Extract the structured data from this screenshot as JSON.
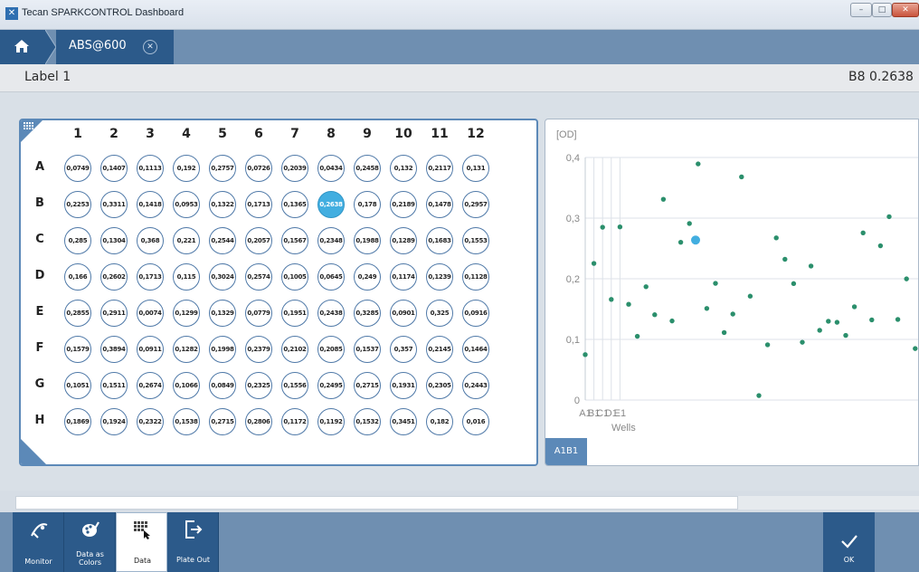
{
  "window": {
    "title": "Tecan SPARKCONTROL Dashboard",
    "app_icon": "tecan-logo-icon"
  },
  "nav": {
    "home_icon": "home-icon",
    "tab_label": "ABS@600",
    "tab_close_icon": "close-circle-icon"
  },
  "label_bar": {
    "left": "Label 1",
    "right": "B8 0.2638"
  },
  "plate": {
    "columns": [
      "1",
      "2",
      "3",
      "4",
      "5",
      "6",
      "7",
      "8",
      "9",
      "10",
      "11",
      "12"
    ],
    "rows": [
      "A",
      "B",
      "C",
      "D",
      "E",
      "F",
      "G",
      "H"
    ],
    "values": [
      [
        "0,0749",
        "0,1407",
        "0,1113",
        "0,192",
        "0,2757",
        "0,0726",
        "0,2039",
        "0,0434",
        "0,2458",
        "0,132",
        "0,2117",
        "0,131"
      ],
      [
        "0,2253",
        "0,3311",
        "0,1418",
        "0,0953",
        "0,1322",
        "0,1713",
        "0,1365",
        "0,2638",
        "0,178",
        "0,2189",
        "0,1478",
        "0,2957"
      ],
      [
        "0,285",
        "0,1304",
        "0,368",
        "0,221",
        "0,2544",
        "0,2057",
        "0,1567",
        "0,2348",
        "0,1988",
        "0,1289",
        "0,1683",
        "0,1553"
      ],
      [
        "0,166",
        "0,2602",
        "0,1713",
        "0,115",
        "0,3024",
        "0,2574",
        "0,1005",
        "0,0645",
        "0,249",
        "0,1174",
        "0,1239",
        "0,1128"
      ],
      [
        "0,2855",
        "0,2911",
        "0,0074",
        "0,1299",
        "0,1329",
        "0,0779",
        "0,1951",
        "0,2438",
        "0,3285",
        "0,0901",
        "0,325",
        "0,0916"
      ],
      [
        "0,1579",
        "0,3894",
        "0,0911",
        "0,1282",
        "0,1998",
        "0,2379",
        "0,2102",
        "0,2085",
        "0,1537",
        "0,357",
        "0,2145",
        "0,1464"
      ],
      [
        "0,1051",
        "0,1511",
        "0,2674",
        "0,1066",
        "0,0849",
        "0,2325",
        "0,1556",
        "0,2495",
        "0,2715",
        "0,1931",
        "0,2305",
        "0,2443"
      ],
      [
        "0,1869",
        "0,1924",
        "0,2322",
        "0,1538",
        "0,2715",
        "0,2806",
        "0,1172",
        "0,1192",
        "0,1532",
        "0,3451",
        "0,182",
        "0,016"
      ]
    ],
    "selected_well": "B8",
    "selected_color": "#42aee0"
  },
  "chart_data": {
    "type": "scatter",
    "ylabel": "[OD]",
    "xlabel": "Wells",
    "x_tick_labels": [
      "A1",
      "B1",
      "C1",
      "D1",
      "E1"
    ],
    "y_ticks": [
      0,
      0.1,
      0.2,
      0.3,
      0.4
    ],
    "y_tick_labels": [
      "0",
      "0,1",
      "0,2",
      "0,3",
      "0,4"
    ],
    "ylim": [
      0,
      0.4
    ],
    "grid": true,
    "series": [
      {
        "color": "#2b8f6c",
        "x": [
          "A1",
          "B1",
          "C1",
          "D1",
          "E1",
          "F1",
          "G1",
          "H1",
          "A2",
          "B2",
          "C2",
          "D2",
          "E2",
          "F2",
          "G2",
          "H2",
          "A3",
          "B3",
          "C3",
          "D3",
          "E3",
          "F3",
          "G3",
          "H3",
          "A4",
          "B4",
          "C4",
          "D4",
          "E4",
          "F4",
          "G4",
          "H4",
          "A5",
          "B5",
          "C5",
          "D5",
          "E5",
          "F5",
          "G5",
          "H5",
          "A6",
          "B6",
          "C6",
          "D6",
          "E6",
          "F6",
          "G6",
          "H6",
          "A7",
          "B7",
          "C7",
          "D7",
          "E7",
          "F7",
          "G7",
          "H7"
        ],
        "values": [
          0.0749,
          0.2253,
          0.285,
          0.166,
          0.2855,
          0.1579,
          0.1051,
          0.1869,
          0.1407,
          0.3311,
          0.1304,
          0.2602,
          0.2911,
          0.3894,
          0.1511,
          0.1924,
          0.1113,
          0.1418,
          0.368,
          0.1713,
          0.0074,
          0.0911,
          0.2674,
          0.2322,
          0.192,
          0.0953,
          0.221,
          0.115,
          0.1299,
          0.1282,
          0.1066,
          0.1538,
          0.2757,
          0.1322,
          0.2544,
          0.3024,
          0.1329,
          0.1998,
          0.0849,
          0.2715,
          0.0726,
          0.1713,
          0.2057,
          0.2574,
          0.0779,
          0.2379,
          0.2325,
          0.2806,
          0.2039,
          0.1365,
          0.1567,
          0.1005,
          0.1951,
          0.2102,
          0.1556,
          0.1172
        ]
      }
    ],
    "highlight": {
      "well": "B8",
      "value": 0.2638,
      "color": "#42aee0"
    }
  },
  "progress": {
    "fraction": 0.8
  },
  "toolbar": {
    "items": [
      {
        "label": "Monitor",
        "icon": "monitor-icon",
        "active": false
      },
      {
        "label": "Data as Colors",
        "icon": "palette-icon",
        "active": false
      },
      {
        "label": "Data",
        "icon": "data-grid-icon",
        "active": true
      },
      {
        "label": "Plate Out",
        "icon": "plate-out-icon",
        "active": false
      }
    ],
    "ok_label": "OK",
    "ok_icon": "check-icon"
  }
}
